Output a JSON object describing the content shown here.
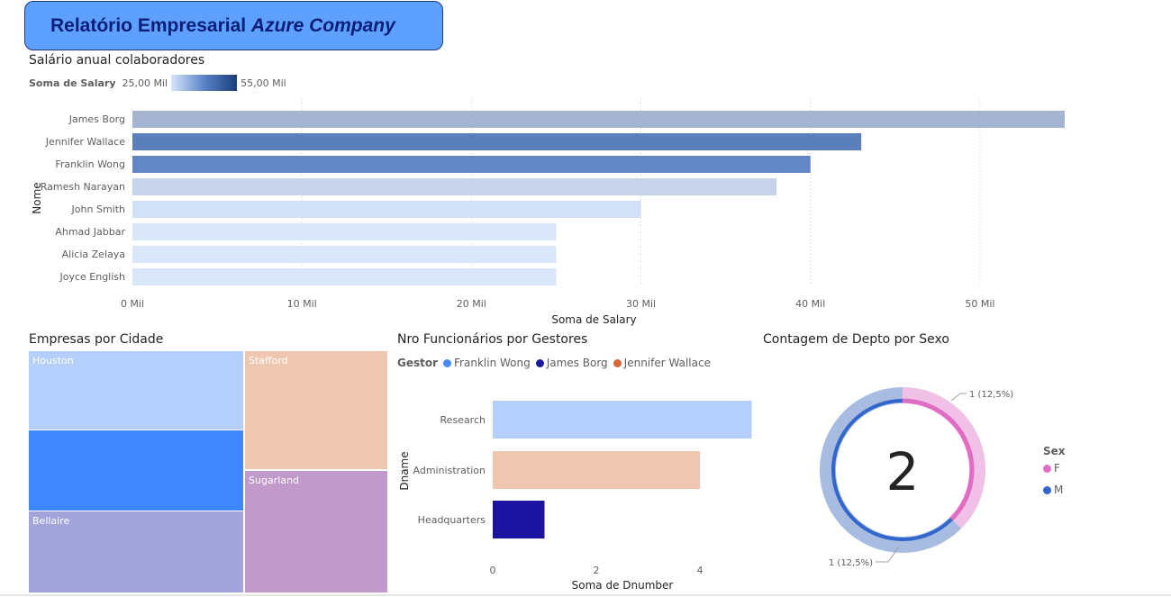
{
  "header": {
    "title_plain": "Relatório Empresarial ",
    "title_italic": "Azure Company"
  },
  "salary_chart": {
    "title": "Salário anual colaboradores",
    "legend_label": "Soma de Salary",
    "legend_min": "25,00 Mil",
    "legend_max": "55,00 Mil",
    "chart_data": {
      "type": "bar",
      "orientation": "horizontal",
      "categories": [
        "James Borg",
        "Jennifer Wallace",
        "Franklin Wong",
        "Ramesh Narayan",
        "John Smith",
        "Ahmad Jabbar",
        "Alicia Zelaya",
        "Joyce English"
      ],
      "values": [
        55000,
        43000,
        40000,
        38000,
        30000,
        25000,
        25000,
        25000
      ],
      "colors": [
        "#a5b4d1",
        "#5a7fba",
        "#6287c4",
        "#c6d3e9",
        "#d2e1f8",
        "#dae7fb",
        "#dae7fb",
        "#dae7fb"
      ],
      "xlabel": "Soma de Salary",
      "ylabel": "Nome",
      "xlim": [
        0,
        55000
      ],
      "xticks": [
        0,
        10000,
        20000,
        30000,
        40000,
        50000
      ],
      "xtick_labels": [
        "0 Mil",
        "10 Mil",
        "20 Mil",
        "30 Mil",
        "40 Mil",
        "50 Mil"
      ],
      "grid": true
    }
  },
  "treemap": {
    "title": "Empresas por Cidade",
    "chart_data": {
      "type": "treemap",
      "tiles": [
        {
          "label": "Houston",
          "color": "#b4cffb"
        },
        {
          "label": "",
          "color": "#3f88fd"
        },
        {
          "label": "Bellaire",
          "color": "#a3a5da"
        },
        {
          "label": "Stafford",
          "color": "#efc6b0"
        },
        {
          "label": "Sugarland",
          "color": "#c19acb"
        }
      ]
    }
  },
  "gestores_chart": {
    "title": "Nro Funcionários por Gestores",
    "legend_title": "Gestor",
    "legend": [
      {
        "name": "Franklin Wong",
        "color": "#4a8af5"
      },
      {
        "name": "James Borg",
        "color": "#1a1aa0"
      },
      {
        "name": "Jennifer Wallace",
        "color": "#d9673a"
      }
    ],
    "chart_data": {
      "type": "bar",
      "orientation": "horizontal",
      "categories": [
        "Research",
        "Administration",
        "Headquarters"
      ],
      "values": [
        5,
        4,
        1
      ],
      "colors": [
        "#b4cffb",
        "#efc6b0",
        "#1c13a0"
      ],
      "series_by_category": [
        "Franklin Wong",
        "Jennifer Wallace",
        "James Borg"
      ],
      "xlabel": "Soma de Dnumber",
      "ylabel": "Dname",
      "xlim": [
        0,
        5
      ],
      "xticks": [
        0,
        2,
        4
      ],
      "xtick_labels": [
        "0",
        "2",
        "4"
      ]
    }
  },
  "donut_chart": {
    "title": "Contagem de Depto por Sexo",
    "center_value": "2",
    "legend_title": "Sex",
    "legend": [
      {
        "name": "F",
        "color": "#e06cc4"
      },
      {
        "name": "M",
        "color": "#3366cc"
      }
    ],
    "chart_data": {
      "type": "pie",
      "categories": [
        "F",
        "M"
      ],
      "values": [
        1,
        1
      ],
      "percent_labels": [
        "1 (12,5%)",
        "1 (12,5%)"
      ],
      "outer_colors": [
        "#f0c0e6",
        "#a8bce2"
      ],
      "inner_colors": [
        "#e06cc4",
        "#3366cc"
      ],
      "f_fraction": 0.375
    }
  }
}
